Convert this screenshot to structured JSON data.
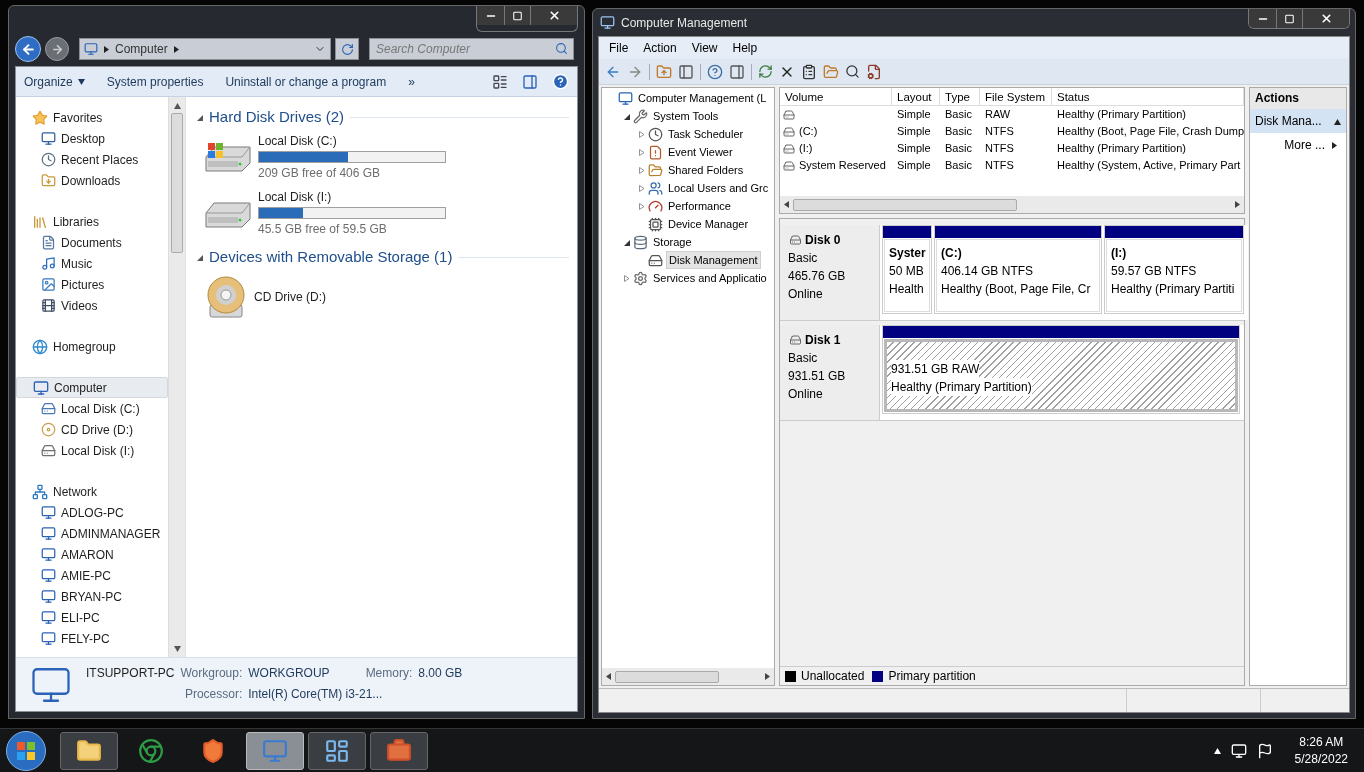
{
  "explorer": {
    "address": {
      "segments": [
        "Computer"
      ]
    },
    "search": {
      "placeholder": "Search Computer"
    },
    "toolbar": [
      {
        "label": "Organize",
        "dropdown": true
      },
      {
        "label": "System properties",
        "dropdown": false
      },
      {
        "label": "Uninstall or change a program",
        "dropdown": false
      },
      {
        "label": "»",
        "dropdown": false
      }
    ],
    "sidebar": [
      {
        "label": "Favorites",
        "selected": false,
        "children": [
          {
            "label": "Desktop",
            "selected": false
          },
          {
            "label": "Recent Places",
            "selected": false
          },
          {
            "label": "Downloads",
            "selected": false
          }
        ]
      },
      {
        "label": "Libraries",
        "selected": false,
        "children": [
          {
            "label": "Documents",
            "selected": false
          },
          {
            "label": "Music",
            "selected": false
          },
          {
            "label": "Pictures",
            "selected": false
          },
          {
            "label": "Videos",
            "selected": false
          }
        ]
      },
      {
        "label": "Homegroup",
        "selected": false
      },
      {
        "label": "Computer",
        "selected": true,
        "children": [
          {
            "label": "Local Disk (C:)",
            "selected": false
          },
          {
            "label": "CD Drive (D:)",
            "selected": false
          },
          {
            "label": "Local Disk (I:)",
            "selected": false
          }
        ]
      },
      {
        "label": "Network",
        "selected": false,
        "children": [
          {
            "label": "ADLOG-PC",
            "selected": false
          },
          {
            "label": "ADMINMANAGER",
            "selected": false
          },
          {
            "label": "AMARON",
            "selected": false
          },
          {
            "label": "AMIE-PC",
            "selected": false
          },
          {
            "label": "BRYAN-PC",
            "selected": false
          },
          {
            "label": "ELI-PC",
            "selected": false
          },
          {
            "label": "FELY-PC",
            "selected": false
          }
        ]
      }
    ],
    "groups": [
      {
        "title": "Hard Disk Drives (2)",
        "expanded": true,
        "items": [
          {
            "name": "Local Disk (C:)",
            "kind": "system-drive",
            "level": 0.48,
            "free": "209 GB free of 406 GB"
          },
          {
            "name": "Local Disk (I:)",
            "kind": "drive",
            "level": 0.235,
            "free": "45.5 GB free of 59.5 GB"
          }
        ]
      },
      {
        "title": "Devices with Removable Storage (1)",
        "expanded": true,
        "items": [
          {
            "name": "CD Drive (D:)",
            "kind": "cd"
          }
        ]
      }
    ],
    "details": {
      "name": "ITSUPPORT-PC",
      "fields": [
        {
          "label": "Workgroup:",
          "value": "WORKGROUP"
        },
        {
          "label": "Memory:",
          "value": "8.00 GB"
        },
        {
          "label": "Processor:",
          "value": "Intel(R) Core(TM) i3-21..."
        }
      ]
    }
  },
  "management": {
    "title": "Computer Management",
    "menu": [
      "File",
      "Action",
      "View",
      "Help"
    ],
    "tree": [
      {
        "label": "Computer Management (L",
        "selected": false,
        "children": [
          {
            "label": "System Tools",
            "expanded": true,
            "selected": false,
            "children": [
              {
                "label": "Task Scheduler",
                "expanded": false,
                "selected": false
              },
              {
                "label": "Event Viewer",
                "expanded": false,
                "selected": false
              },
              {
                "label": "Shared Folders",
                "expanded": false,
                "selected": false
              },
              {
                "label": "Local Users and Grc",
                "expanded": false,
                "selected": false
              },
              {
                "label": "Performance",
                "expanded": false,
                "selected": false
              },
              {
                "label": "Device Manager",
                "selected": false
              }
            ]
          },
          {
            "label": "Storage",
            "expanded": true,
            "selected": false,
            "children": [
              {
                "label": "Disk Management",
                "selected": true
              }
            ]
          },
          {
            "label": "Services and Applicatio",
            "expanded": false,
            "selected": false
          }
        ]
      }
    ],
    "columns": [
      "Volume",
      "Layout",
      "Type",
      "File System",
      "Status"
    ],
    "volumes": [
      {
        "cells": [
          "",
          "Simple",
          "Basic",
          "RAW",
          "Healthy (Primary Partition)"
        ]
      },
      {
        "cells": [
          "(C:)",
          "Simple",
          "Basic",
          "NTFS",
          "Healthy (Boot, Page File, Crash Dump"
        ]
      },
      {
        "cells": [
          "(I:)",
          "Simple",
          "Basic",
          "NTFS",
          "Healthy (Primary Partition)"
        ]
      },
      {
        "cells": [
          "System Reserved",
          "Simple",
          "Basic",
          "NTFS",
          "Healthy (System, Active, Primary Part"
        ]
      }
    ],
    "disks": [
      {
        "name": "Disk 0",
        "type": "Basic",
        "size": "465.76 GB",
        "status": "Online",
        "partitions": [
          {
            "kind": "primary",
            "title": "Syster",
            "lines": [
              "50 MB",
              "Health"
            ]
          },
          {
            "kind": "primary",
            "title": "(C:)",
            "lines": [
              "406.14 GB NTFS",
              "Healthy (Boot, Page File, Cr"
            ]
          },
          {
            "kind": "primary",
            "title": "(I:)",
            "lines": [
              "59.57 GB NTFS",
              "Healthy (Primary Partiti"
            ]
          }
        ]
      },
      {
        "name": "Disk 1",
        "type": "Basic",
        "size": "931.51 GB",
        "status": "Online",
        "partitions": [
          {
            "kind": "raw",
            "lines": [
              "931.51 GB RAW",
              "Healthy (Primary Partition)"
            ]
          }
        ]
      }
    ],
    "legend": [
      {
        "label": "Unallocated",
        "color": "#000000"
      },
      {
        "label": "Primary partition",
        "color": "#000080"
      }
    ],
    "actions": {
      "header": "Actions",
      "items": [
        {
          "kind": "section",
          "label": "Disk Mana..."
        },
        {
          "kind": "more",
          "label": "More ..."
        }
      ]
    }
  },
  "taskbar": {
    "apps": [
      {
        "kind": "folder",
        "active": false,
        "running": true
      },
      {
        "kind": "browser",
        "active": false,
        "running": false
      },
      {
        "kind": "lion",
        "active": false,
        "running": false
      },
      {
        "kind": "computer",
        "active": true,
        "running": true
      },
      {
        "kind": "panel",
        "active": false,
        "running": true
      },
      {
        "kind": "toolbox",
        "active": false,
        "running": true
      }
    ],
    "clock": {
      "time": "8:26 AM",
      "date": "5/28/2022"
    }
  }
}
